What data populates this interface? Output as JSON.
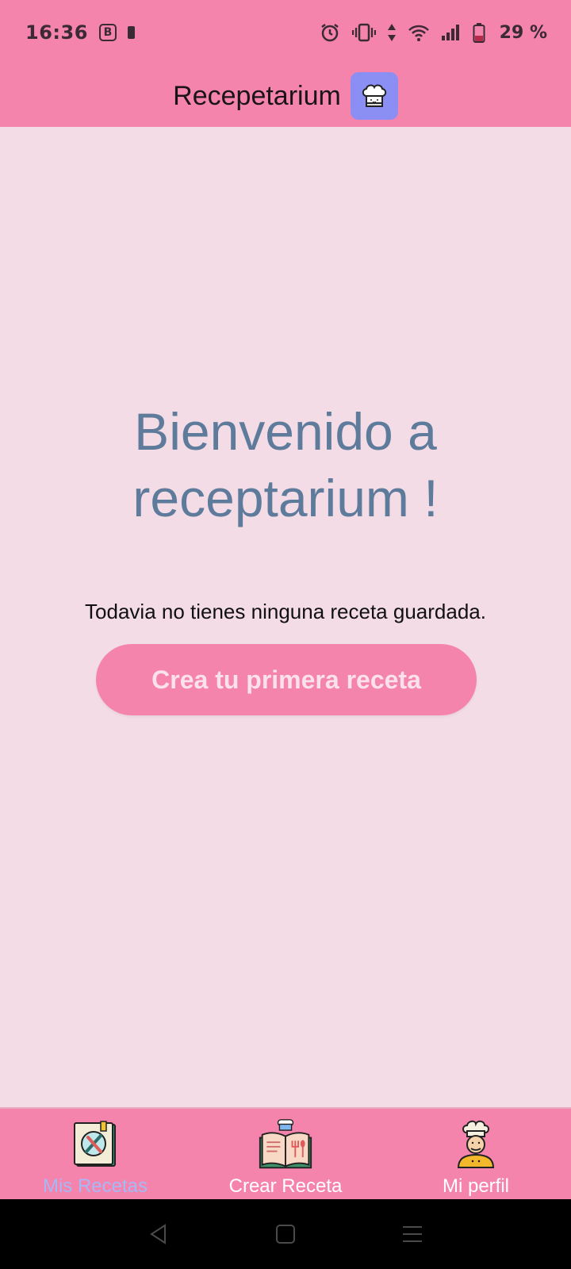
{
  "status_bar": {
    "time": "16:36",
    "app_badge": "B",
    "battery_percent": "29 %",
    "icons": [
      "alarm-icon",
      "vibrate-icon",
      "data-arrows-icon",
      "wifi-icon",
      "signal-icon",
      "battery-icon"
    ]
  },
  "app_bar": {
    "title": "Recepetarium",
    "logo_icon": "chef-hat-icon"
  },
  "main": {
    "welcome_line1": "Bienvenido a",
    "welcome_line2": "receptarium !",
    "empty_message": "Todavia no tienes ninguna receta guardada.",
    "cta_label": "Crea tu primera receta"
  },
  "bottom_nav": {
    "items": [
      {
        "label": "Mis Recetas",
        "icon": "recipe-book-icon",
        "active": true
      },
      {
        "label": "Crear Receta",
        "icon": "open-cookbook-icon",
        "active": false
      },
      {
        "label": "Mi perfil",
        "icon": "chef-avatar-icon",
        "active": false
      }
    ]
  },
  "system_nav": {
    "buttons": [
      "back-icon",
      "home-icon",
      "menu-icon"
    ]
  },
  "colors": {
    "bar_pink": "#f584ad",
    "background": "#f3dce6",
    "welcome_text": "#5f7b9c",
    "logo_bg": "#8b8ef2",
    "active_nav": "#a6b8f5"
  }
}
